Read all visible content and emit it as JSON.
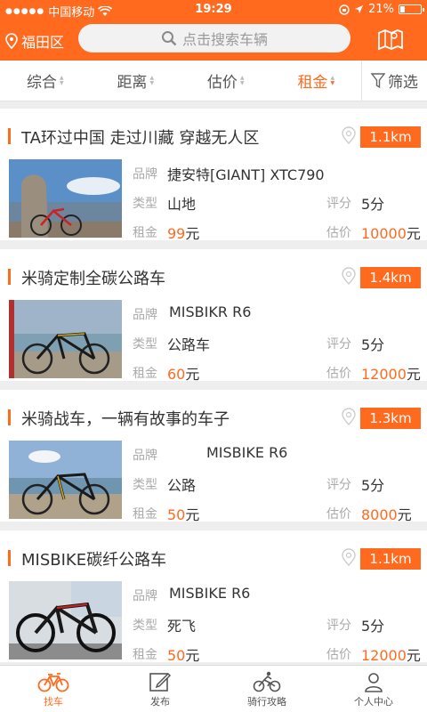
{
  "statusbar": {
    "carrier": "中国移动",
    "time": "19:29",
    "battery": "21%"
  },
  "header": {
    "location": "福田区",
    "search_placeholder": "点击搜索车辆"
  },
  "filters": [
    {
      "label": "综合"
    },
    {
      "label": "距离"
    },
    {
      "label": "估价"
    },
    {
      "label": "租金",
      "active": true
    },
    {
      "label": "筛选"
    }
  ],
  "field_labels": {
    "brand": "品牌",
    "type": "类型",
    "rent": "租金",
    "rating": "评分",
    "value": "估价",
    "yuan": "元"
  },
  "listings": [
    {
      "title": "TA环过中国 走过川藏 穿越无人区",
      "distance": "1.1km",
      "brand": "捷安特[GIANT] XTC790",
      "type": "山地",
      "rating": "5分",
      "rent": "99",
      "value": "10000"
    },
    {
      "title": "米骑定制全碳公路车",
      "distance": "1.4km",
      "brand": "MISBIKR R6",
      "type": "公路车",
      "rating": "5分",
      "rent": "60",
      "value": "12000"
    },
    {
      "title": "米骑战车，一辆有故事的车子",
      "distance": "1.3km",
      "brand": "MISBIKE  R6",
      "type": "公路",
      "rating": "5分",
      "rent": "50",
      "value": "8000"
    },
    {
      "title": "MISBIKE碳纤公路车",
      "distance": "1.1km",
      "brand": "MISBIKE  R6",
      "type": "死飞",
      "rating": "5分",
      "rent": "50",
      "value": "12000"
    }
  ],
  "tabs": [
    {
      "label": "找车",
      "icon": "bike-icon",
      "active": true
    },
    {
      "label": "发布",
      "icon": "edit-icon"
    },
    {
      "label": "骑行攻略",
      "icon": "cyclist-icon"
    },
    {
      "label": "个人中心",
      "icon": "person-icon"
    }
  ],
  "colors": {
    "accent": "#ff6a1f"
  }
}
